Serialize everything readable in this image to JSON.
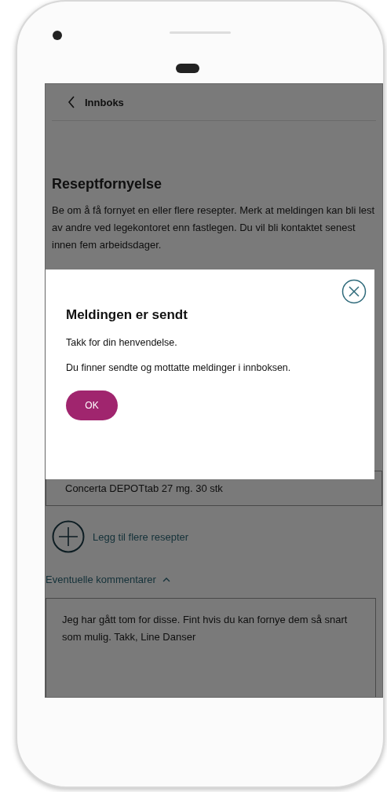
{
  "top_bar": {
    "back_label": "Innboks"
  },
  "page": {
    "title": "Reseptfornyelse",
    "intro": "Be om å få fornyet en eller flere resepter. Merk at meldingen kan bli lest av andre ved legekontoret enn fastlegen. Du vil bli kontaktet senest innen fem arbeidsdager."
  },
  "prescriptions": [
    {
      "value": "Concerta DEPOTtab 27 mg. 30 stk"
    }
  ],
  "add_button": "Legg til flere resepter",
  "comments": {
    "label": "Eventuelle kommentarer",
    "expanded": true,
    "value": "Jeg har gått tom for disse. Fint hvis du kan fornye dem så snart som mulig. Takk, Line Danser"
  },
  "dialog": {
    "title": "Meldingen er sendt",
    "lines": [
      "Takk for din henvendelse.",
      "Du finner sendte og mottatte meldinger i innboksen."
    ],
    "button": "OK"
  }
}
